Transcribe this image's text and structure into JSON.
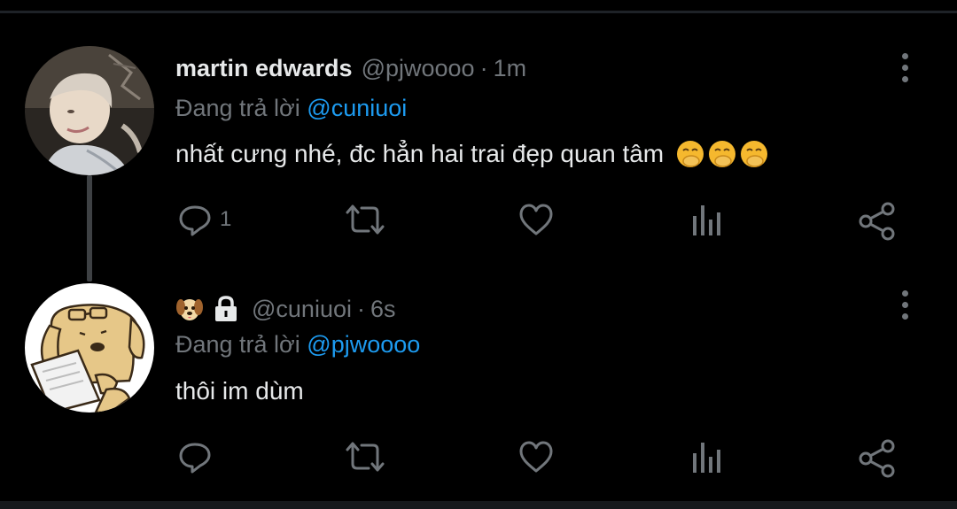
{
  "tweets": [
    {
      "name": "martin edwards",
      "handle": "@pjwoooo",
      "separator": "·",
      "time": "1m",
      "replying_prefix": "Đang trả lời",
      "replying_to": "@cuniuoi",
      "text": "nhất cưng nhé, đc hẳn hai trai đẹp quan tâm",
      "emojis": [
        "face-with-hand-over-mouth",
        "face-with-hand-over-mouth",
        "face-with-hand-over-mouth"
      ],
      "reply_count": "1",
      "avatar_icon": "user-photo-avatar"
    },
    {
      "name_icons": [
        "dog-face-emoji",
        "lock-icon"
      ],
      "handle": "@cuniuoi",
      "separator": "·",
      "time": "6s",
      "replying_prefix": "Đang trả lời",
      "replying_to": "@pjwoooo",
      "text": "thôi im dùm",
      "reply_count": "",
      "avatar_icon": "cartoon-dog-avatar"
    }
  ],
  "action_icons": [
    "reply-icon",
    "retweet-icon",
    "like-icon",
    "analytics-icon",
    "share-icon"
  ],
  "colors": {
    "background": "#000000",
    "text_primary": "#e7e9ea",
    "text_secondary": "#71767b",
    "mention": "#1d9bf0",
    "thread_line": "#3e4144"
  }
}
